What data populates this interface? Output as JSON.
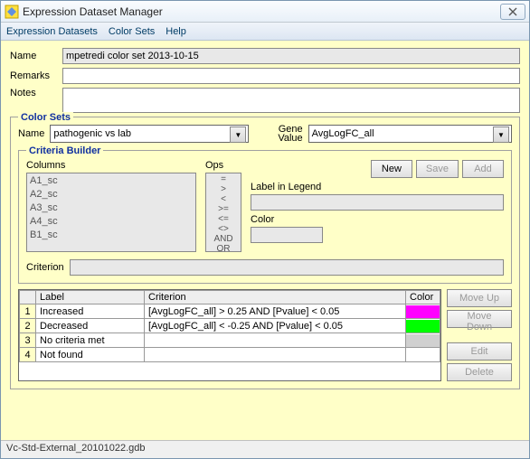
{
  "window": {
    "title": "Expression Dataset Manager"
  },
  "menu": {
    "item0": "Expression Datasets",
    "item1": "Color Sets",
    "item2": "Help"
  },
  "form": {
    "name_label": "Name",
    "name_value": "mpetredi color set 2013-10-15",
    "remarks_label": "Remarks",
    "remarks_value": "",
    "notes_label": "Notes",
    "notes_value": ""
  },
  "colorsets": {
    "legend": "Color Sets",
    "name_label": "Name",
    "name_value": "pathogenic vs lab",
    "gene_label1": "Gene",
    "gene_label2": "Value",
    "gene_value": "AvgLogFC_all"
  },
  "criteria": {
    "legend": "Criteria Builder",
    "columns_label": "Columns",
    "columns": {
      "c0": "A1_sc",
      "c1": "A2_sc",
      "c2": "A3_sc",
      "c3": "A4_sc",
      "c4": "B1_sc"
    },
    "ops_label": "Ops",
    "ops": {
      "o0": "=",
      "o1": ">",
      "o2": "<",
      "o3": ">=",
      "o4": "<=",
      "o5": "<>",
      "o6": "AND",
      "o7": "OR"
    },
    "new_btn": "New",
    "save_btn": "Save",
    "add_btn": "Add",
    "label_label": "Label in Legend",
    "label_value": "",
    "color_label": "Color",
    "criterion_label": "Criterion",
    "criterion_value": ""
  },
  "table": {
    "h_num": "",
    "h_label": "Label",
    "h_criterion": "Criterion",
    "h_color": "Color",
    "rows": [
      {
        "n": "1",
        "label": "Increased",
        "criterion": "[AvgLogFC_all] > 0.25 AND [Pvalue] < 0.05",
        "color": "#ff00ff"
      },
      {
        "n": "2",
        "label": "Decreased",
        "criterion": "[AvgLogFC_all] < -0.25 AND [Pvalue] < 0.05",
        "color": "#00ff00"
      },
      {
        "n": "3",
        "label": "No criteria met",
        "criterion": "",
        "color": "#d0d0d0"
      },
      {
        "n": "4",
        "label": "Not found",
        "criterion": "",
        "color": "#ffffff"
      }
    ]
  },
  "sidebtns": {
    "moveup": "Move Up",
    "movedown": "Move Down",
    "edit": "Edit",
    "delete": "Delete"
  },
  "status": "Vc-Std-External_20101022.gdb"
}
